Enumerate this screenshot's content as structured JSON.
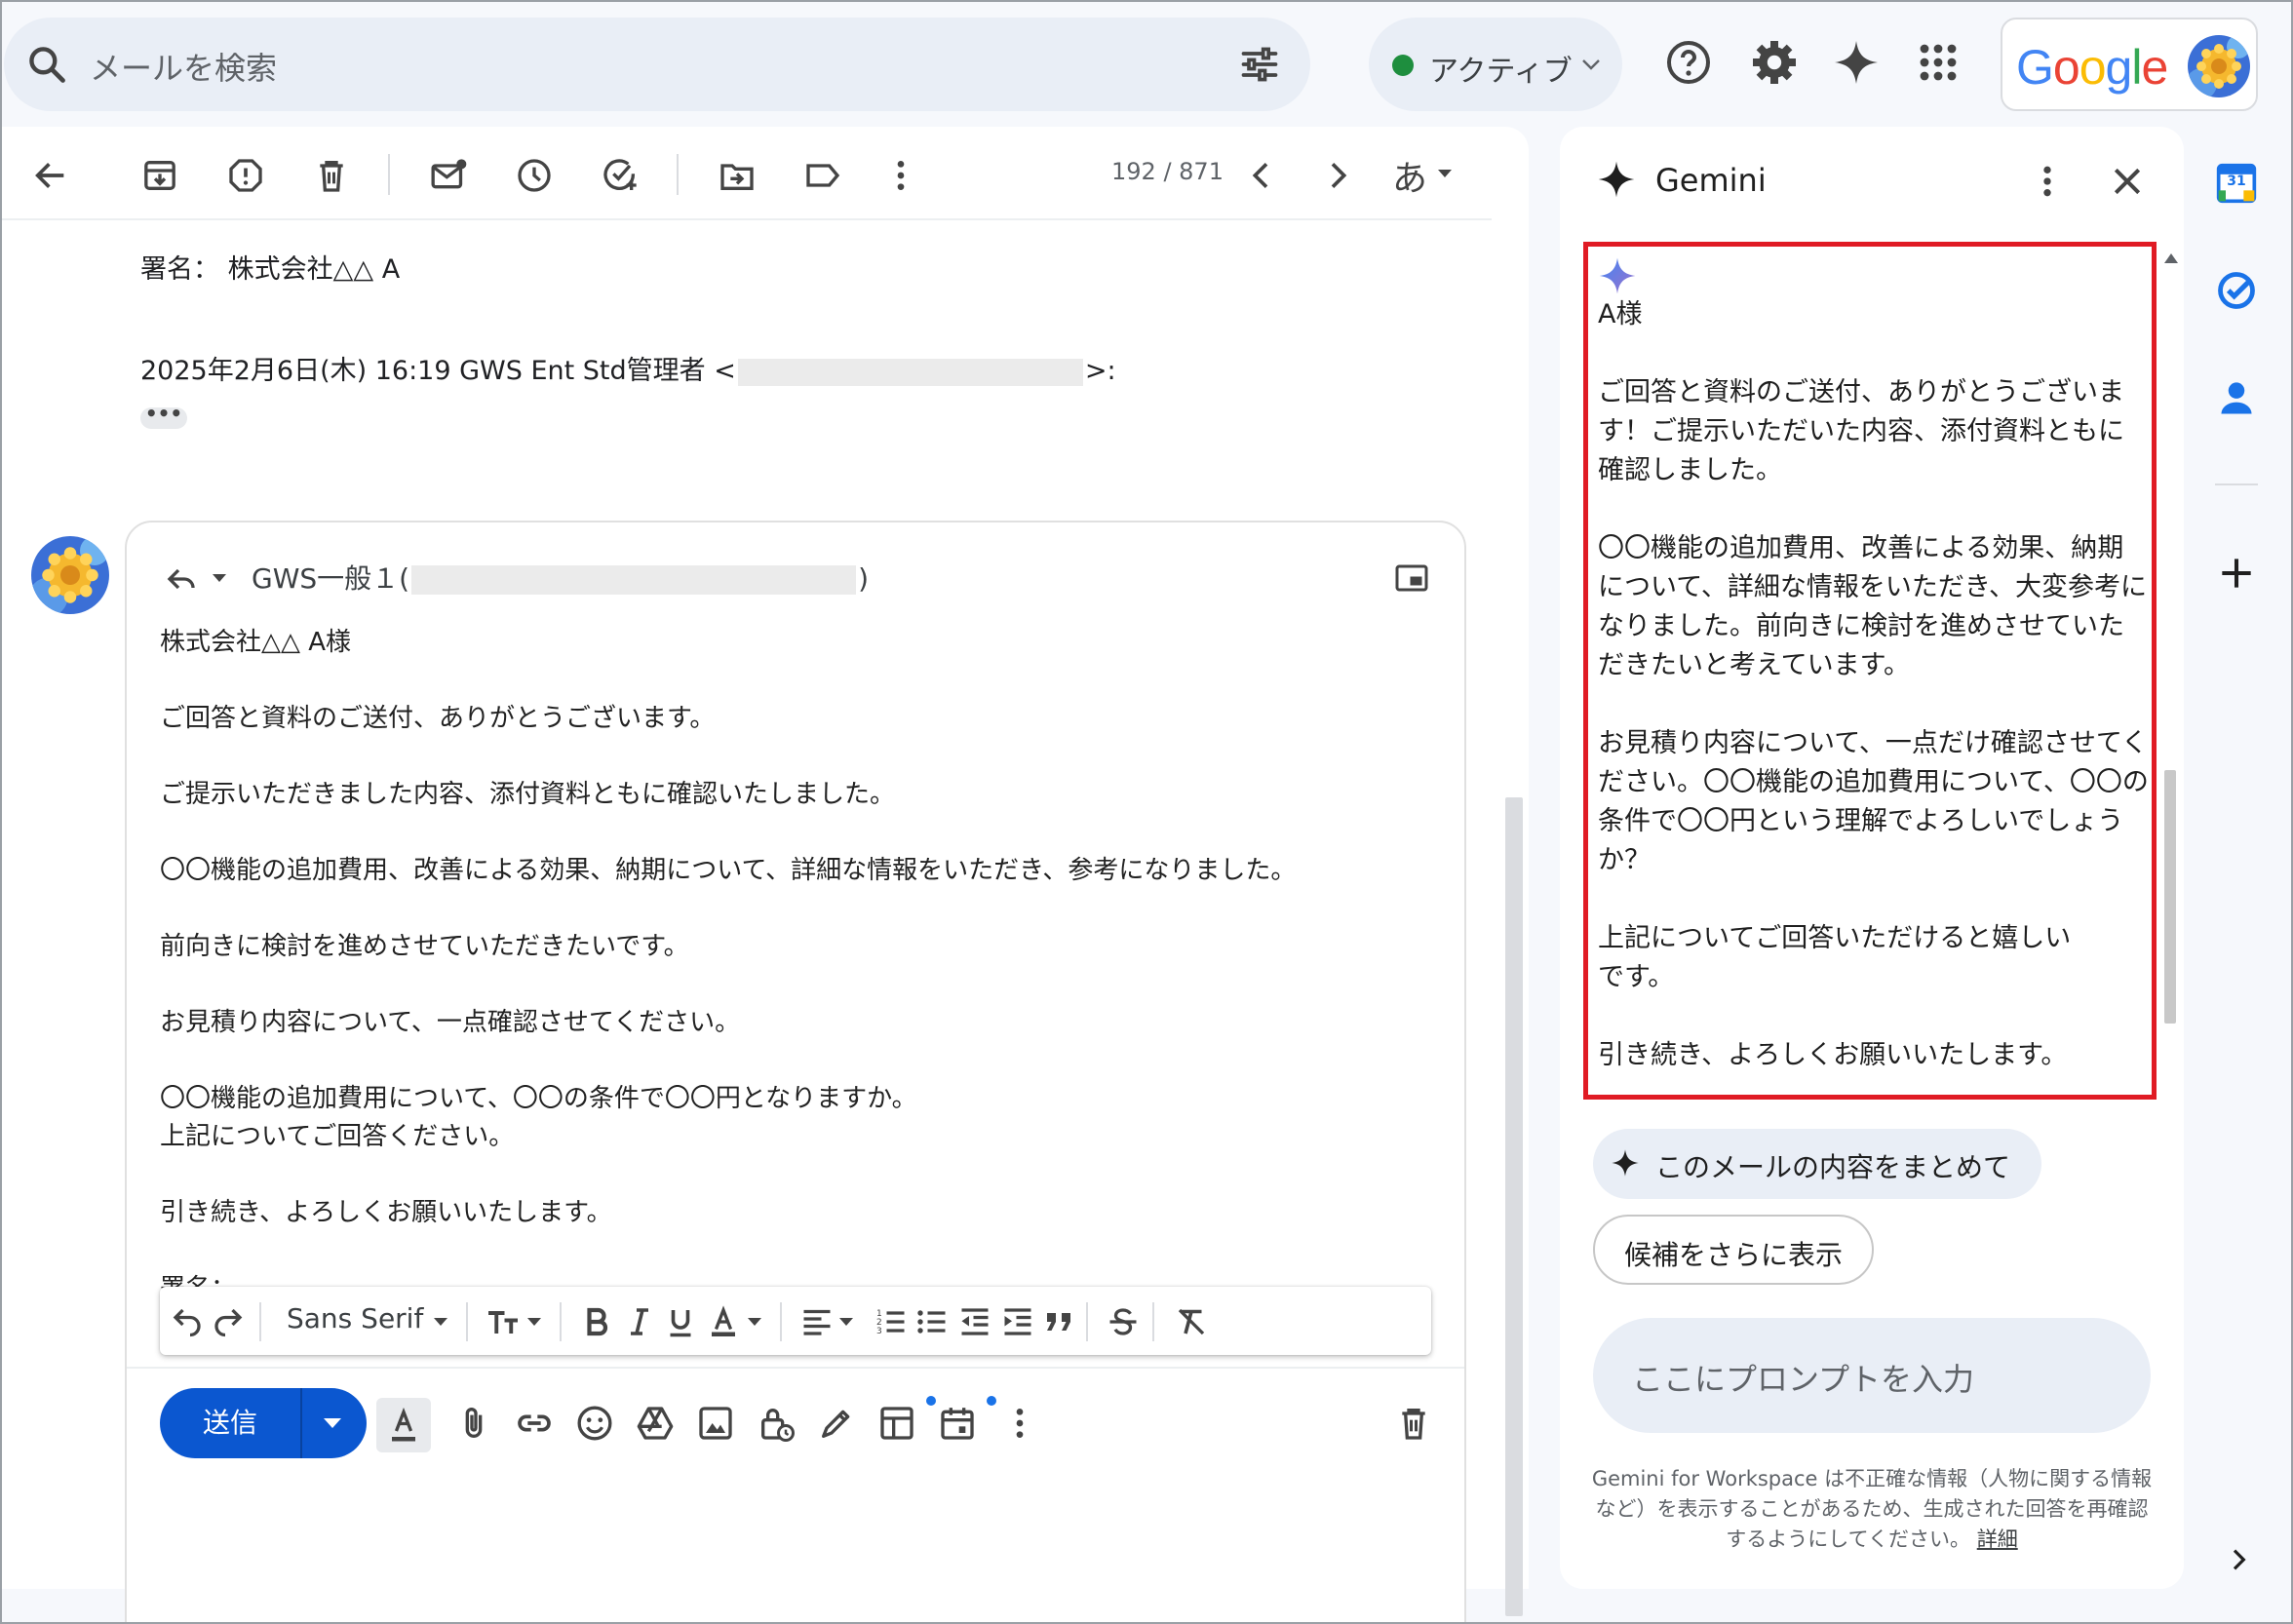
{
  "search": {
    "placeholder": "メールを検索",
    "icon": "search-icon",
    "filter_icon": "tune-icon"
  },
  "status": {
    "label": "アクティブ",
    "color": "#1e8e3e"
  },
  "topbar": {
    "icons": [
      "help-icon",
      "settings-icon",
      "gemini-sparkle-icon",
      "apps-grid-icon"
    ],
    "brand": "Google"
  },
  "mail_toolbar": {
    "icons": [
      "back-icon",
      "archive-icon",
      "report-spam-icon",
      "delete-icon",
      "mark-unread-icon",
      "snooze-icon",
      "add-task-icon",
      "move-to-icon",
      "label-icon",
      "more-icon"
    ],
    "counter": "192 / 871",
    "input_mode": "あ"
  },
  "thread": {
    "signature_line": "署名： 株式会社△△ A",
    "quote_prefix": "2025年2月6日(木) 16:19 GWS Ent Std管理者 <",
    "quote_suffix": ">:",
    "ellipsis": "•••"
  },
  "compose": {
    "to_prefix": "GWS一般１(",
    "to_suffix": ")",
    "body": "株式会社△△ A様\n\nご回答と資料のご送付、ありがとうございます。\n\nご提示いただきました内容、添付資料ともに確認いたしました。\n\n〇〇機能の追加費用、改善による効果、納期について、詳細な情報をいただき、参考になりました。\n\n前向きに検討を進めさせていただきたいです。\n\nお見積り内容について、一点確認させてください。\n\n〇〇機能の追加費用について、〇〇の条件で〇〇円となりますか。\n上記についてご回答ください。\n\n引き続き、よろしくお願いいたします。\n\n署名：\nB",
    "font_name": "Sans Serif",
    "send_label": "送信",
    "accent": "#0b57d0"
  },
  "gemini": {
    "title": "Gemini",
    "response": "A様\n\nご回答と資料のご送付、ありがとうございます！ご提示いただいた内容、添付資料ともに確認しました。\n\n〇〇機能の追加費用、改善による効果、納期について、詳細な情報をいただき、大変参考になりました。前向きに検討を進めさせていただきたいと考えています。\n\nお見積り内容について、一点だけ確認させてください。〇〇機能の追加費用について、〇〇の条件で〇〇円という理解でよろしいでしょうか？\n\n上記についてご回答いただけると嬉しい\nです。\n\n引き続き、よろしくお願いいたします。",
    "highlight_color": "#e01b24",
    "chip_summarize": "このメールの内容をまとめて",
    "chip_more": "候補をさらに表示",
    "prompt_placeholder": "ここにプロンプトを入力",
    "disclaimer_brand": "Gemini for Workspace",
    "disclaimer_text": " は不正確な情報（人物に関する情報など）を表示することがあるため、生成された回答を再確認するようにしてください。",
    "disclaimer_link": "詳細"
  },
  "rail": {
    "calendar_day": "31",
    "icons": [
      "calendar-icon",
      "tasks-icon",
      "contacts-icon",
      "add-icon",
      "expand-icon"
    ]
  }
}
